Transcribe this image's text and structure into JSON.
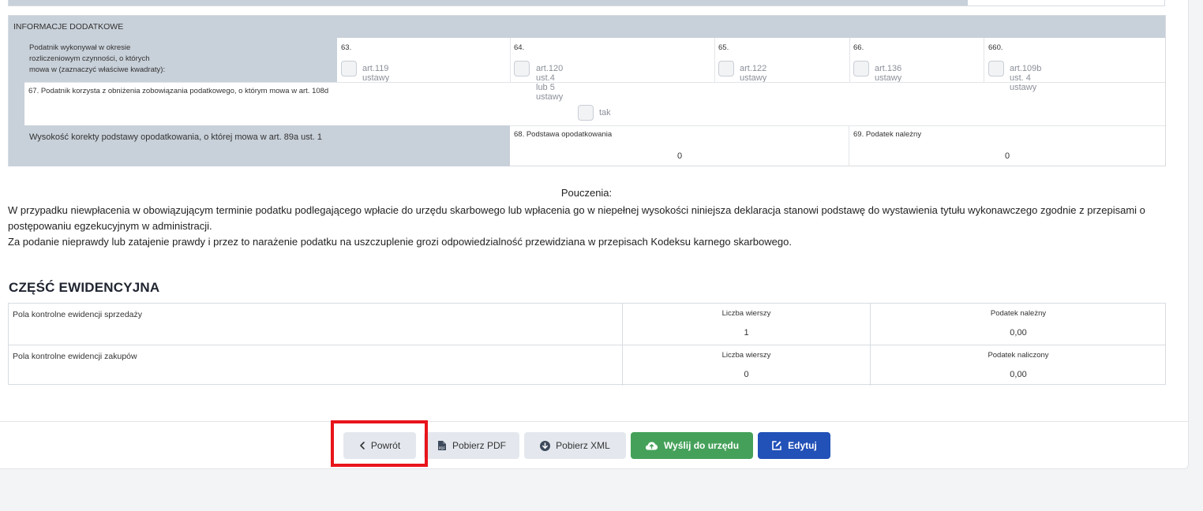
{
  "info": {
    "header": "INFORMACJE DODATKOWE",
    "row1_label_lines": [
      "Podatnik wykonywał w okresie",
      "rozliczeniowym czynności, o których",
      "mowa w (zaznaczyć właściwe kwadraty):"
    ],
    "options": [
      {
        "num": "63.",
        "label": "art.119 ustawy"
      },
      {
        "num": "64.",
        "label": "art.120 ust.4 lub 5 ustawy"
      },
      {
        "num": "65.",
        "label": "art.122 ustawy"
      },
      {
        "num": "66.",
        "label": "art.136 ustawy"
      },
      {
        "num": "660.",
        "label": "art.109b ust. 4 ustawy"
      }
    ],
    "row2_label": "67. Podatnik korzysta z obniżenia zobowiązania podatkowego, o którym mowa w art. 108d",
    "row2_option": "tak",
    "row3_label": "Wysokość korekty podstawy opodatkowania, o której mowa w art. 89a ust. 1",
    "row3_field1_label": "68. Podstawa opodatkowania",
    "row3_field1_value": "0",
    "row3_field2_label": "69. Podatek należny",
    "row3_field2_value": "0"
  },
  "pouczenia": {
    "title": "Pouczenia:",
    "line1": "W przypadku niewpłacenia w obowiązującym terminie podatku podlegającego wpłacie do urzędu skarbowego lub wpłacenia go w niepełnej wysokości niniejsza deklaracja stanowi podstawę do wystawienia tytułu wykonawczego zgodnie z przepisami o postępowaniu egzekucyjnym w administracji.",
    "line2": "Za podanie nieprawdy lub zatajenie prawdy i przez to narażenie podatku na uszczuplenie grozi odpowiedzialność przewidziana w przepisach Kodeksu karnego skarbowego."
  },
  "ewidencja": {
    "title": "CZĘŚĆ EWIDENCYJNA",
    "rows": [
      {
        "label": "Pola kontrolne ewidencji sprzedaży",
        "h1": "Liczba wierszy",
        "v1": "1",
        "h2": "Podatek należny",
        "v2": "0,00"
      },
      {
        "label": "Pola kontrolne ewidencji zakupów",
        "h1": "Liczba wierszy",
        "v1": "0",
        "h2": "Podatek naliczony",
        "v2": "0,00"
      }
    ]
  },
  "buttons": {
    "back": "Powrót",
    "pdf": "Pobierz PDF",
    "xml": "Pobierz XML",
    "send": "Wyślij do urzędu",
    "edit": "Edytuj"
  },
  "colors": {
    "header_gray": "#c8d0d9",
    "green": "#45a15a",
    "blue": "#2251b8",
    "highlight": "#e8141b"
  }
}
